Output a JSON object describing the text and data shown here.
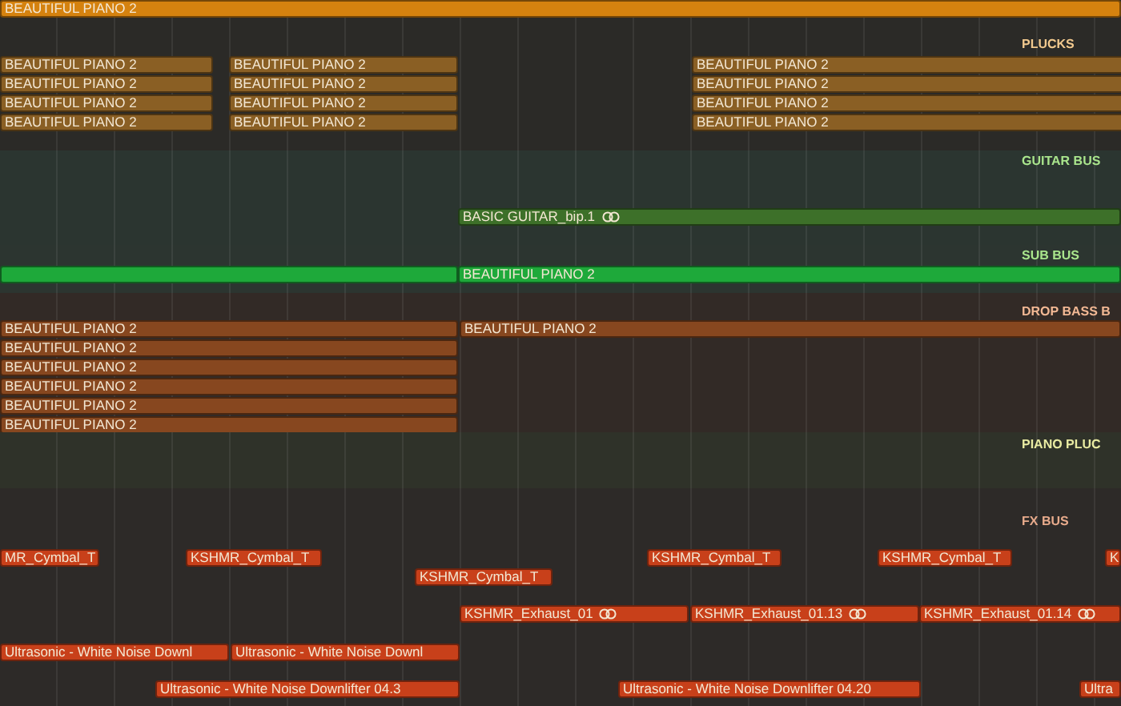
{
  "sections": [
    {
      "label": "PLUCKS",
      "color": "#f2c98e",
      "lanes": [
        {
          "regions": [
            {
              "name": "BEAUTIFUL PIANO 2",
              "color": "#d5820f"
            }
          ]
        },
        {
          "regions": [
            {
              "name": "BEAUTIFUL PIANO 2",
              "color": "#8a5f24"
            },
            {
              "name": "BEAUTIFUL PIANO 2",
              "color": "#8a5f24"
            },
            {
              "name": "BEAUTIFUL PIANO 2",
              "color": "#8a5f24"
            }
          ]
        },
        {
          "regions": [
            {
              "name": "BEAUTIFUL PIANO 2",
              "color": "#8a5f24"
            },
            {
              "name": "BEAUTIFUL PIANO 2",
              "color": "#8a5f24"
            },
            {
              "name": "BEAUTIFUL PIANO 2",
              "color": "#8a5f24"
            }
          ]
        },
        {
          "regions": [
            {
              "name": "BEAUTIFUL PIANO 2",
              "color": "#8a5f24"
            },
            {
              "name": "BEAUTIFUL PIANO 2",
              "color": "#8a5f24"
            },
            {
              "name": "BEAUTIFUL PIANO 2",
              "color": "#8a5f24"
            }
          ]
        },
        {
          "regions": [
            {
              "name": "BEAUTIFUL PIANO 2",
              "color": "#8a5f24"
            },
            {
              "name": "BEAUTIFUL PIANO 2",
              "color": "#8a5f24"
            },
            {
              "name": "BEAUTIFUL PIANO 2",
              "color": "#8a5f24"
            }
          ]
        }
      ]
    },
    {
      "label": "GUITAR BUS",
      "color": "#a9e58c",
      "lanes": [
        {
          "regions": [
            {
              "name": "BASIC GUITAR_bip.1",
              "color": "#3d7029",
              "loop": true
            }
          ]
        }
      ]
    },
    {
      "label": "SUB BUS",
      "color": "#a9e58c",
      "lanes": [
        {
          "regions": [
            {
              "color": "#1ea93a"
            },
            {
              "name": "BEAUTIFUL PIANO 2",
              "color": "#1ea93a"
            }
          ]
        }
      ]
    },
    {
      "label": "DROP BASS B",
      "color": "#f2b894",
      "lanes": [
        {
          "regions": [
            {
              "name": "BEAUTIFUL PIANO 2",
              "color": "#87471f"
            },
            {
              "name": "BEAUTIFUL PIANO 2",
              "color": "#87471f"
            }
          ]
        },
        {
          "regions": [
            {
              "name": "BEAUTIFUL PIANO 2",
              "color": "#87471f"
            }
          ]
        },
        {
          "regions": [
            {
              "name": "BEAUTIFUL PIANO 2",
              "color": "#87471f"
            }
          ]
        },
        {
          "regions": [
            {
              "name": "BEAUTIFUL PIANO 2",
              "color": "#87471f"
            }
          ]
        },
        {
          "regions": [
            {
              "name": "BEAUTIFUL PIANO 2",
              "color": "#87471f"
            }
          ]
        },
        {
          "regions": [
            {
              "name": "BEAUTIFUL PIANO 2",
              "color": "#87471f"
            }
          ]
        }
      ]
    },
    {
      "label": "PIANO PLUC",
      "color": "#e9eba2"
    },
    {
      "label": "FX BUS",
      "color": "#e8ab8c",
      "lanes": [
        {
          "regions": [
            {
              "name": "MR_Cymbal_T",
              "color": "#c8401a"
            },
            {
              "name": "KSHMR_Cymbal_T",
              "color": "#c8401a"
            },
            {
              "name": "KSHMR_Cymbal_T",
              "color": "#c8401a"
            },
            {
              "name": "KSHMR_Cymbal_T",
              "color": "#c8401a"
            },
            {
              "name": "K",
              "color": "#c8401a"
            }
          ]
        },
        {
          "regions": [
            {
              "name": "KSHMR_Cymbal_T",
              "color": "#c8401a"
            }
          ]
        },
        {
          "regions": [
            {
              "name": "KSHMR_Exhaust_01",
              "color": "#c8401a",
              "loop": true
            },
            {
              "name": "KSHMR_Exhaust_01.13",
              "color": "#c8401a",
              "loop": true
            },
            {
              "name": "KSHMR_Exhaust_01.14",
              "color": "#c8401a",
              "loop": true
            }
          ]
        },
        {
          "regions": [
            {
              "name": "Ultrasonic - White Noise Downl",
              "color": "#c8401a"
            },
            {
              "name": "Ultrasonic - White Noise Downl",
              "color": "#c8401a"
            }
          ]
        },
        {
          "regions": [
            {
              "name": "Ultrasonic - White Noise Downlifter 04.3",
              "color": "#c8401a"
            },
            {
              "name": "Ultrasonic - White Noise Downlifter 04.20",
              "color": "#c8401a"
            },
            {
              "name": "Ultra",
              "color": "#c8401a"
            }
          ]
        }
      ]
    }
  ]
}
